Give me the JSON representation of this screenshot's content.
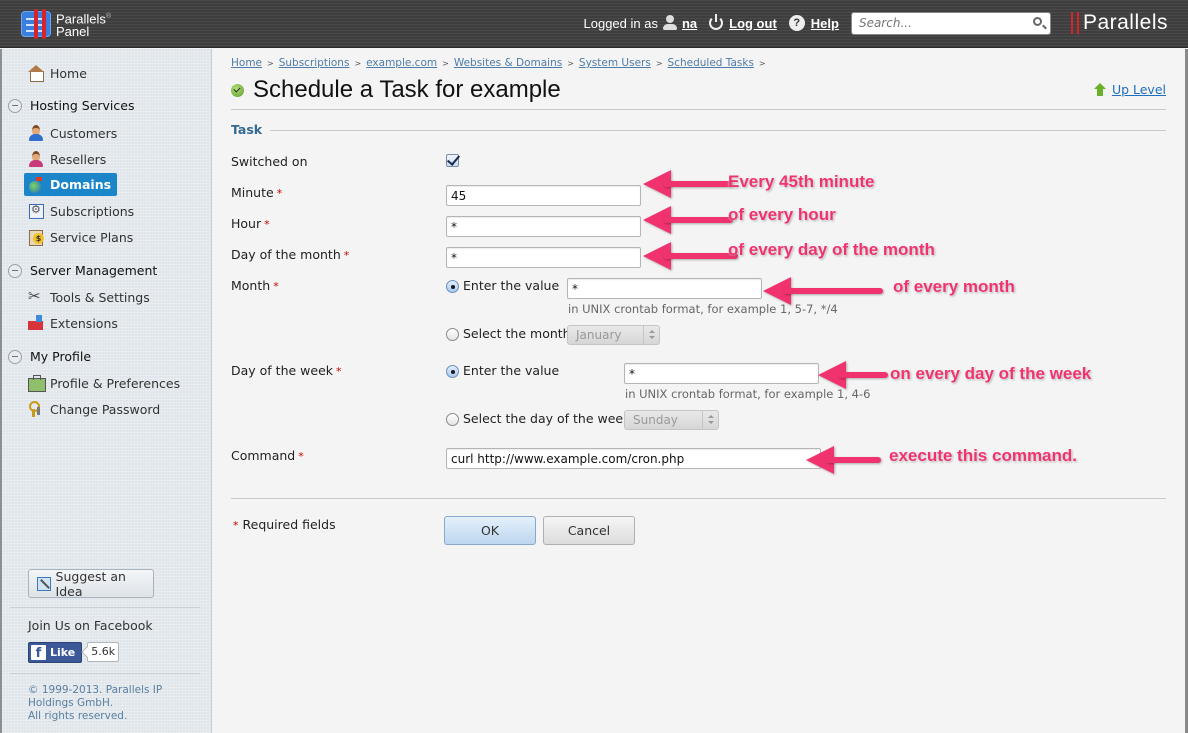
{
  "header": {
    "logo_line1": "Parallels",
    "logo_line2": "Panel",
    "logged_in_label": "Logged in as",
    "username": "na",
    "logout_label": "Log out",
    "help_label": "Help",
    "search_placeholder": "Search...",
    "brand": "Parallels"
  },
  "sidebar": {
    "home": "Home",
    "groups": [
      {
        "title": "Hosting Services",
        "items": [
          "Customers",
          "Resellers",
          "Domains",
          "Subscriptions",
          "Service Plans"
        ]
      },
      {
        "title": "Server Management",
        "items": [
          "Tools & Settings",
          "Extensions"
        ]
      },
      {
        "title": "My Profile",
        "items": [
          "Profile & Preferences",
          "Change Password"
        ]
      }
    ],
    "active_item": "Domains",
    "suggest_label": "Suggest an Idea",
    "facebook_title": "Join Us on Facebook",
    "like_label": "Like",
    "like_count": "5.6k",
    "copyright_line1": "© 1999-2013. Parallels IP Holdings GmbH.",
    "copyright_line2": "All rights reserved."
  },
  "breadcrumb": [
    "Home",
    "Subscriptions",
    "example.com",
    "Websites & Domains",
    "System Users",
    "Scheduled Tasks"
  ],
  "page": {
    "title": "Schedule a Task for example",
    "up_level": "Up Level",
    "section": "Task"
  },
  "form": {
    "required_marker": "*",
    "switched_on": {
      "label": "Switched on",
      "checked": true
    },
    "minute": {
      "label": "Minute",
      "value": "45"
    },
    "hour": {
      "label": "Hour",
      "value": "*"
    },
    "day_of_month": {
      "label": "Day of the month",
      "value": "*"
    },
    "month": {
      "label": "Month",
      "enter_option": "Enter the value",
      "value": "*",
      "hint": "in UNIX crontab format, for example 1, 5-7, */4",
      "select_option": "Select the month",
      "select_value": "January",
      "mode": "enter"
    },
    "day_of_week": {
      "label": "Day of the week",
      "enter_option": "Enter the value",
      "value": "*",
      "hint": "in UNIX crontab format, for example 1, 4-6",
      "select_option": "Select the day of the week",
      "select_value": "Sunday",
      "mode": "enter"
    },
    "command": {
      "label": "Command",
      "value": "curl http://www.example.com/cron.php"
    },
    "required_note": "Required fields",
    "ok_label": "OK",
    "cancel_label": "Cancel"
  },
  "annotations": {
    "color": "#f0336f",
    "minute": "Every 45th minute",
    "hour": "of every hour",
    "day_of_month": "of every day of the month",
    "month": "of every month",
    "day_of_week": "on every day of the week",
    "command": "execute this command."
  }
}
